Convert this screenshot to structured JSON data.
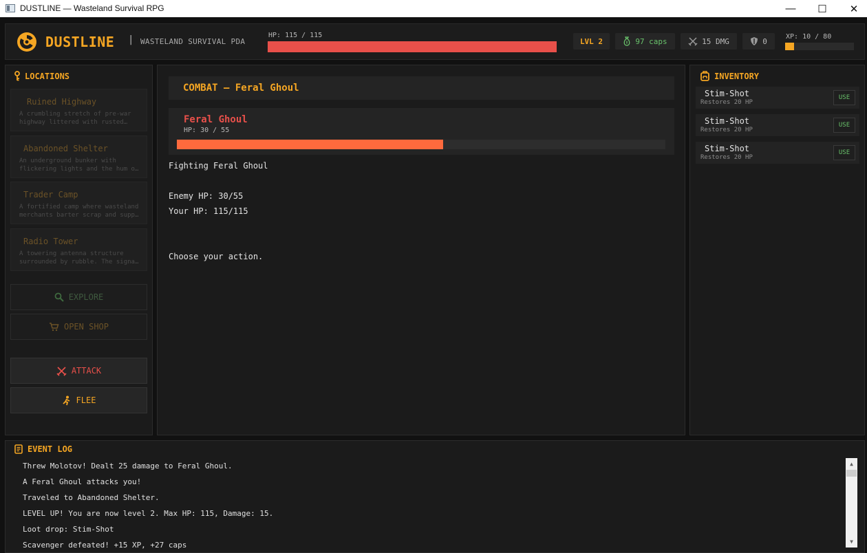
{
  "window": {
    "title": "DUSTLINE — Wasteland Survival RPG",
    "minimize": "—",
    "maximize": "☐",
    "close": "✕"
  },
  "header": {
    "brand": "DUSTLINE",
    "separator": "|",
    "subtitle": "WASTELAND SURVIVAL PDA",
    "hp_label": "HP: 115 / 115",
    "hp_fraction": 1.0,
    "level": "LVL 2",
    "caps": "97 caps",
    "damage": "15 DMG",
    "armor": "0",
    "xp_label": "XP: 10 / 80",
    "xp_fraction": 0.125
  },
  "locations": {
    "title": "LOCATIONS",
    "items": [
      {
        "name": "Ruined Highway",
        "desc1": "A crumbling stretch of pre-war",
        "desc2": "highway littered with rusted…"
      },
      {
        "name": "Abandoned Shelter",
        "desc1": "An underground bunker with",
        "desc2": "flickering lights and the hum o…"
      },
      {
        "name": "Trader Camp",
        "desc1": "A fortified camp where wasteland",
        "desc2": "merchants barter scrap and supp…"
      },
      {
        "name": "Radio Tower",
        "desc1": "A towering antenna structure",
        "desc2": "surrounded by rubble. The signa…"
      }
    ],
    "explore_label": "EXPLORE",
    "shop_label": "OPEN SHOP",
    "attack_label": "ATTACK",
    "flee_label": "FLEE"
  },
  "combat": {
    "header": "COMBAT —  Feral Ghoul",
    "enemy_name": "Feral Ghoul",
    "enemy_hp_label": "HP: 30  / 55",
    "enemy_hp_fraction": 0.545,
    "lines": [
      "Fighting  Feral Ghoul",
      "Enemy HP: 30/55",
      "Your HP: 115/115",
      "Choose your action."
    ]
  },
  "inventory": {
    "title": "INVENTORY",
    "items": [
      {
        "name": "Stim-Shot",
        "desc": "Restores 20 HP",
        "action": "USE"
      },
      {
        "name": "Stim-Shot",
        "desc": "Restores 20 HP",
        "action": "USE"
      },
      {
        "name": "Stim-Shot",
        "desc": "Restores 20 HP",
        "action": "USE"
      }
    ]
  },
  "log": {
    "title": "EVENT LOG",
    "lines": [
      "Threw Molotov! Dealt 25 damage to Feral Ghoul.",
      "A Feral Ghoul attacks you!",
      "Traveled to Abandoned Shelter.",
      "LEVEL UP! You are now level 2. Max HP: 115, Damage: 15.",
      "Loot drop:  Stim-Shot",
      "Scavenger defeated! +15 XP, +27 caps"
    ]
  },
  "colors": {
    "accent": "#f5a623",
    "danger": "#e8504a",
    "enemy_bar": "#ff6a3d",
    "money": "#69c26b"
  }
}
